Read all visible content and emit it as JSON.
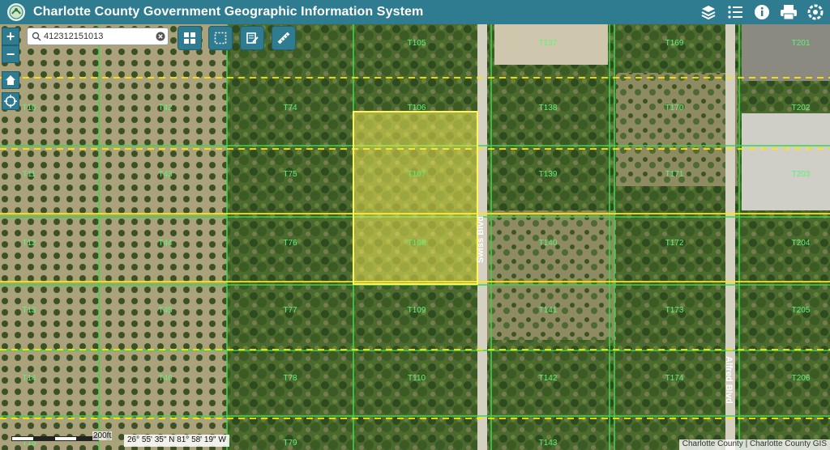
{
  "header": {
    "title": "Charlotte County Government Geographic Information System",
    "icons": [
      "layers-icon",
      "legend-list-icon",
      "info-icon",
      "print-icon",
      "tools-icon"
    ]
  },
  "search": {
    "value": "412312151013",
    "placeholder": "Search"
  },
  "zoom": {
    "in_label": "+",
    "out_label": "−"
  },
  "map": {
    "parcel_labels": [
      "T10",
      "T11",
      "T12",
      "T13",
      "T14",
      "T15",
      "T42",
      "T43",
      "T44",
      "T45",
      "T46",
      "T74",
      "T75",
      "T76",
      "T77",
      "T78",
      "T79",
      "T105",
      "T106",
      "T107",
      "T108",
      "T109",
      "T110",
      "T137",
      "T138",
      "T139",
      "T140",
      "T141",
      "T142",
      "T143",
      "T169",
      "T170",
      "T171",
      "T172",
      "T173",
      "T174",
      "T201",
      "T202",
      "T203",
      "T204",
      "T205",
      "T206"
    ],
    "road_labels": [
      "Swiss Blvd",
      "Alfred Blvd"
    ],
    "selected_parcels": [
      "T106",
      "T107",
      "T108"
    ],
    "colors": {
      "parcel_line": "#3fd34a",
      "section_line": "#ffe600",
      "parcel_label": "#5ff07a",
      "highlight": "#fff45a"
    }
  },
  "scale": {
    "label": "200ft"
  },
  "coordinates": {
    "text": "26° 55' 35\" N 81° 58' 19\" W"
  },
  "attribution": {
    "text": "Charlotte County | Charlotte County GIS"
  }
}
